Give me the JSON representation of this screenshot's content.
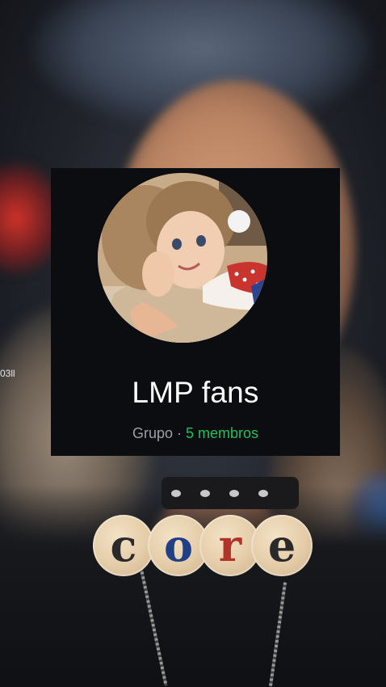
{
  "edge_text": "03ll",
  "group_card": {
    "title": "LMP fans",
    "type_label": "Grupo",
    "separator": "·",
    "members_label": "5 membros"
  },
  "sticker_text": {
    "letters": [
      "c",
      "o",
      "r",
      "e"
    ],
    "colors": [
      "#2a2a2a",
      "#1f3f86",
      "#b3322a",
      "#2a2a2a"
    ]
  },
  "colors": {
    "card_bg": "#0b0d10",
    "members_accent": "#20c05c"
  }
}
